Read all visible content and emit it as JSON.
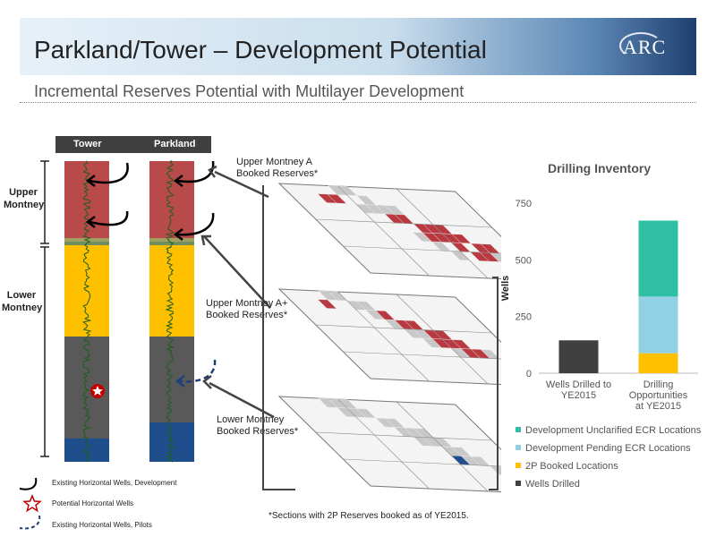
{
  "header": {
    "title": "Parkland/Tower – Development Potential",
    "subtitle": "Incremental Reserves Potential with Multilayer Development",
    "logo_text": "ARC"
  },
  "well_logs": {
    "labels": [
      "Tower",
      "Parkland"
    ],
    "zones": {
      "upper": "Upper Montney",
      "lower": "Lower Montney"
    },
    "colors": {
      "upper": "#b94a4b",
      "band": "#a0a060",
      "lower": "#ffc000",
      "gray": "#595959",
      "blue": "#1f4e8c",
      "log_trace": "#1d5e1d",
      "red_arrow": "#c00000",
      "pilot_arrow": "#1f3f7a"
    }
  },
  "maps": [
    {
      "label": "Upper Montney A Booked Reserves*"
    },
    {
      "label": "Upper Montney A+ Booked Reserves*"
    },
    {
      "label": "Lower Montney Booked Reserves*"
    }
  ],
  "legend_bottom": [
    {
      "icon": "black-arrow-icon",
      "label": "Existing Horizontal Wells, Development"
    },
    {
      "icon": "red-star-icon",
      "label": "Potential Horizontal Wells"
    },
    {
      "icon": "dashed-arrow-icon",
      "label": "Existing Horizontal Wells, Pilots"
    }
  ],
  "footnote": "*Sections with 2P Reserves booked as of YE2015.",
  "chart_data": {
    "type": "bar",
    "title": "Drilling Inventory",
    "ylabel": "Wells",
    "ylim": [
      0,
      750
    ],
    "yticks": [
      0,
      250,
      500,
      750
    ],
    "categories": [
      "Wells Drilled to YE2015",
      "Drilling Opportunities at YE2015"
    ],
    "stacked": true,
    "series": [
      {
        "name": "Wells Drilled",
        "color": "#404040",
        "values": [
          145,
          0
        ]
      },
      {
        "name": "2P Booked Locations",
        "color": "#ffc000",
        "values": [
          0,
          88
        ]
      },
      {
        "name": "Development Pending ECR Locations",
        "color": "#92d0e4",
        "values": [
          0,
          250
        ]
      },
      {
        "name": "Development Unclarified ECR Locations",
        "color": "#2ebfa5",
        "values": [
          0,
          335
        ]
      }
    ],
    "legend": [
      "Development Unclarified ECR Locations",
      "Development Pending ECR Locations",
      "2P Booked Locations",
      "Wells Drilled"
    ],
    "legend_placement": "bottom"
  }
}
